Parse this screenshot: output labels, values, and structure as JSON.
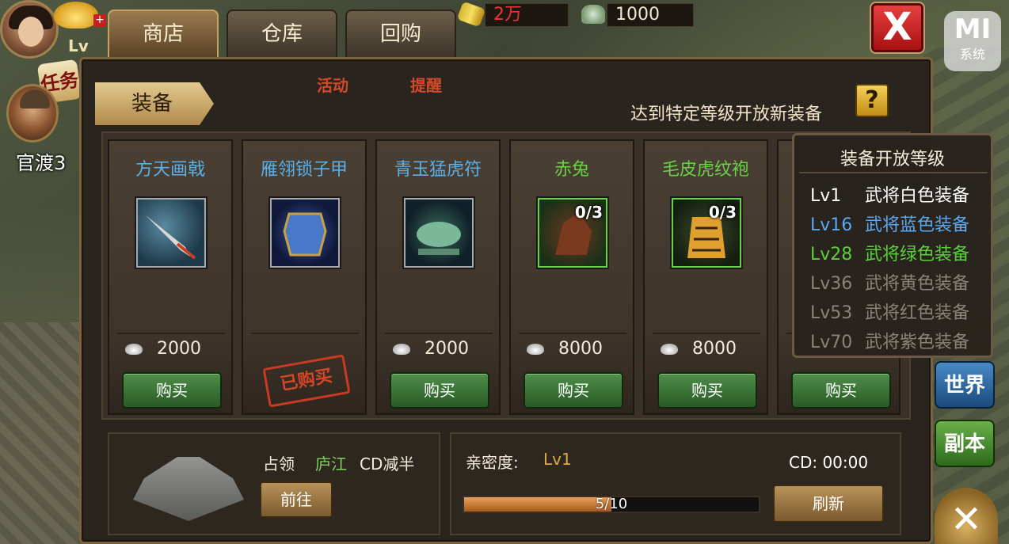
{
  "hud": {
    "level_prefix": "Lv",
    "task_label": "任务",
    "location": "官渡3",
    "scrolls": "2万",
    "silver": "1000",
    "close_glyph": "X",
    "mi_logo": "MI",
    "mi_label": "系统",
    "activity": "活动",
    "reminder": "提醒",
    "world_btn": "世界",
    "copy_btn": "副本",
    "x_glyph": "✕"
  },
  "tabs": [
    {
      "label": "商店",
      "active": true
    },
    {
      "label": "仓库",
      "active": false
    },
    {
      "label": "回购",
      "active": false
    }
  ],
  "section": {
    "tag": "装备",
    "unlock_tip": "达到特定等级开放新装备",
    "help": "?"
  },
  "items": [
    {
      "name": "方天画戟",
      "name_color": "#5ab0e8",
      "icon": "halberd-icon",
      "qty": "",
      "price": "2000",
      "bought": false,
      "buy_label": "购买"
    },
    {
      "name": "雁翎锁子甲",
      "name_color": "#5ab0e8",
      "icon": "armor-icon",
      "qty": "",
      "price": "",
      "bought": true,
      "stamp": "已购买"
    },
    {
      "name": "青玉猛虎符",
      "name_color": "#5ab0e8",
      "icon": "jade-tiger-icon",
      "qty": "",
      "price": "2000",
      "bought": false,
      "buy_label": "购买"
    },
    {
      "name": "赤兔",
      "name_color": "#6ad048",
      "icon": "horse-icon",
      "qty": "0/3",
      "price": "8000",
      "bought": false,
      "buy_label": "购买"
    },
    {
      "name": "毛皮虎纹袍",
      "name_color": "#6ad048",
      "icon": "tiger-robe-icon",
      "qty": "0/3",
      "price": "8000",
      "bought": false,
      "buy_label": "购买"
    },
    {
      "name": "",
      "name_color": "#6ad048",
      "icon": "",
      "qty": "",
      "price": "",
      "bought": false,
      "buy_label": "购买"
    }
  ],
  "occupy": {
    "label": "占领",
    "city": "庐江",
    "cd_text": "CD减半",
    "goto_label": "前往"
  },
  "intimacy": {
    "label": "亲密度:",
    "level": "Lv1",
    "cd": "CD: 00:00",
    "progress_text": "5/10",
    "progress_fraction": 0.5,
    "refresh_label": "刷新"
  },
  "tooltip": {
    "title": "装备开放等级",
    "tiers": [
      {
        "lv": "Lv1",
        "desc": "武将白色装备",
        "color": "#ffffff"
      },
      {
        "lv": "Lv16",
        "desc": "武将蓝色装备",
        "color": "#5aa8f0"
      },
      {
        "lv": "Lv28",
        "desc": "武将绿色装备",
        "color": "#5ad03a"
      },
      {
        "lv": "Lv36",
        "desc": "武将黄色装备",
        "color": "#8a8478"
      },
      {
        "lv": "Lv53",
        "desc": "武将红色装备",
        "color": "#8a8478"
      },
      {
        "lv": "Lv70",
        "desc": "武将紫色装备",
        "color": "#8a8478"
      }
    ]
  }
}
